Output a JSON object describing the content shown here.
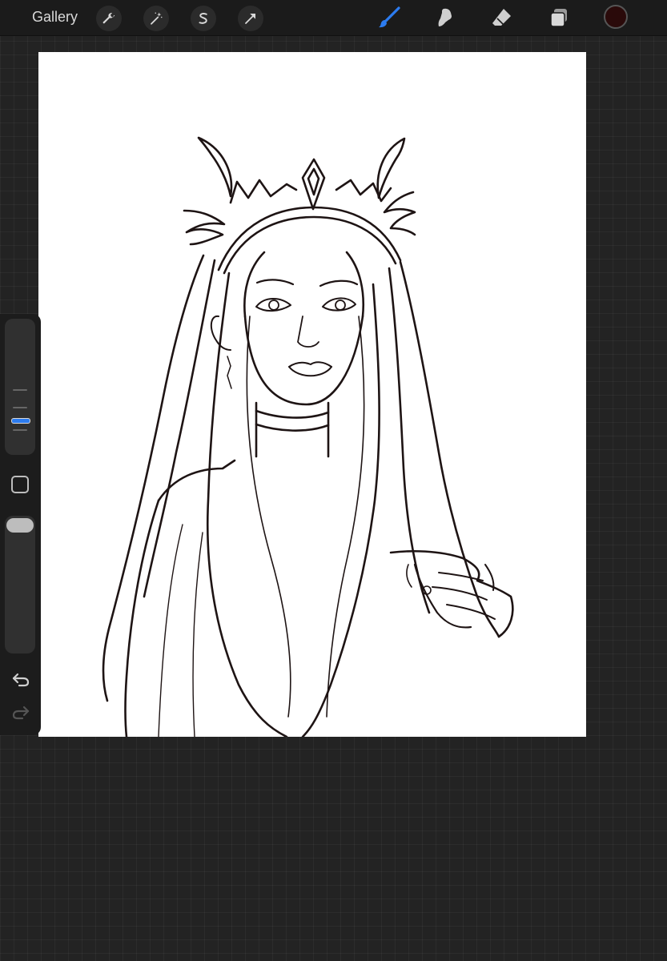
{
  "topbar": {
    "gallery_label": "Gallery",
    "left_tools": [
      "wrench-icon",
      "magic-wand-icon",
      "selection-icon",
      "transform-icon"
    ],
    "right_tools": [
      "brush-icon",
      "smudge-icon",
      "eraser-icon",
      "layers-icon"
    ],
    "active_tool": "brush-icon",
    "current_color": "#2a0a0a"
  },
  "sidebar": {
    "brush_size_level": 0.16,
    "opacity_level": 0.95,
    "undo_icon": "undo-icon",
    "redo_icon": "redo-icon"
  },
  "canvas": {
    "background": "#ffffff",
    "artwork": "line-art"
  },
  "colors": {
    "accent": "#2c7cf0",
    "app_bg": "#232323",
    "bar_bg": "#1b1b1b"
  }
}
